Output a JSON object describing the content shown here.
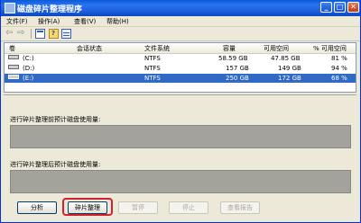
{
  "window": {
    "title": "磁盘碎片整理程序",
    "buttons": {
      "minimize": "_",
      "maximize": "□",
      "close": "✕"
    }
  },
  "menu": [
    "文件(F)",
    "操作(A)",
    "查看(V)",
    "帮助(H)"
  ],
  "toolbar": {
    "icons": [
      "back-arrow-icon",
      "forward-arrow-icon",
      "view-icon",
      "help-icon",
      "properties-icon"
    ],
    "glyphs": {
      "back": "⇦",
      "forward": "⇨"
    }
  },
  "volumes": {
    "columns": [
      "卷",
      "会话状态",
      "文件系统",
      "容量",
      "可用空间",
      "% 可用空间"
    ],
    "rows": [
      {
        "volume": "(C:)",
        "status": "",
        "fs": "NTFS",
        "capacity": "58.59 GB",
        "free": "47.85 GB",
        "pct": "81 %"
      },
      {
        "volume": "(D:)",
        "status": "",
        "fs": "NTFS",
        "capacity": "157 GB",
        "free": "149 GB",
        "pct": "94 %"
      },
      {
        "volume": "(E:)",
        "status": "",
        "fs": "NTFS",
        "capacity": "250 GB",
        "free": "172 GB",
        "pct": "68 %",
        "selected": true
      }
    ]
  },
  "sections": {
    "before_label": "进行碎片整理前预计磁盘使用量:",
    "after_label": "进行碎片整理后预计磁盘使用量:"
  },
  "buttons": {
    "analyze": "分析",
    "defragment": "碎片整理",
    "pause": "暂停",
    "stop": "停止",
    "view_report": "查看报告"
  },
  "colors": {
    "selection": "#316ac5",
    "highlight_border": "#d4202a",
    "titlebar": "#1c5fdc"
  }
}
